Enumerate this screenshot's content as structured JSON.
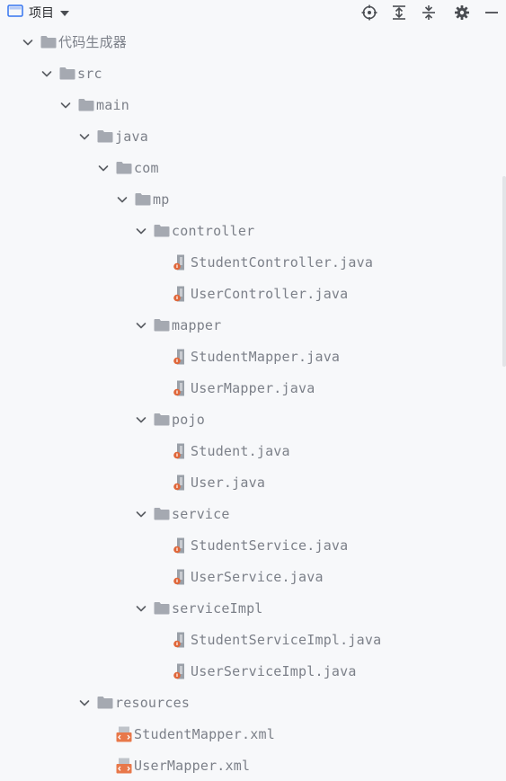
{
  "toolbar": {
    "title": "项目",
    "icons": [
      "locate-icon",
      "expand-all-icon",
      "collapse-all-icon",
      "settings-icon",
      "hide-icon"
    ]
  },
  "tree": [
    {
      "label": "代码生成器",
      "type": "folder",
      "depth": 0,
      "expanded": true
    },
    {
      "label": "src",
      "type": "folder",
      "depth": 1,
      "expanded": true
    },
    {
      "label": "main",
      "type": "folder",
      "depth": 2,
      "expanded": true
    },
    {
      "label": "java",
      "type": "folder",
      "depth": 3,
      "expanded": true
    },
    {
      "label": "com",
      "type": "folder",
      "depth": 4,
      "expanded": true
    },
    {
      "label": "mp",
      "type": "folder",
      "depth": 5,
      "expanded": true
    },
    {
      "label": "controller",
      "type": "folder",
      "depth": 6,
      "expanded": true
    },
    {
      "label": "StudentController.java",
      "type": "java",
      "depth": 7
    },
    {
      "label": "UserController.java",
      "type": "java",
      "depth": 7
    },
    {
      "label": "mapper",
      "type": "folder",
      "depth": 6,
      "expanded": true
    },
    {
      "label": "StudentMapper.java",
      "type": "java",
      "depth": 7
    },
    {
      "label": "UserMapper.java",
      "type": "java",
      "depth": 7
    },
    {
      "label": "pojo",
      "type": "folder",
      "depth": 6,
      "expanded": true
    },
    {
      "label": "Student.java",
      "type": "java",
      "depth": 7
    },
    {
      "label": "User.java",
      "type": "java",
      "depth": 7
    },
    {
      "label": "service",
      "type": "folder",
      "depth": 6,
      "expanded": true
    },
    {
      "label": "StudentService.java",
      "type": "java",
      "depth": 7
    },
    {
      "label": "UserService.java",
      "type": "java",
      "depth": 7
    },
    {
      "label": "serviceImpl",
      "type": "folder",
      "depth": 6,
      "expanded": true
    },
    {
      "label": "StudentServiceImpl.java",
      "type": "java",
      "depth": 7
    },
    {
      "label": "UserServiceImpl.java",
      "type": "java",
      "depth": 7
    },
    {
      "label": "resources",
      "type": "folder",
      "depth": 3,
      "expanded": true
    },
    {
      "label": "StudentMapper.xml",
      "type": "xml",
      "depth": 4
    },
    {
      "label": "UserMapper.xml",
      "type": "xml",
      "depth": 4
    }
  ],
  "colors": {
    "background": "#f7f8fa",
    "text": "#7c8089",
    "folder": "#a5a9b1",
    "java_icon": "#9aa0a8",
    "java_badge": "#e0673a",
    "xml_icon": "#e8784a"
  }
}
